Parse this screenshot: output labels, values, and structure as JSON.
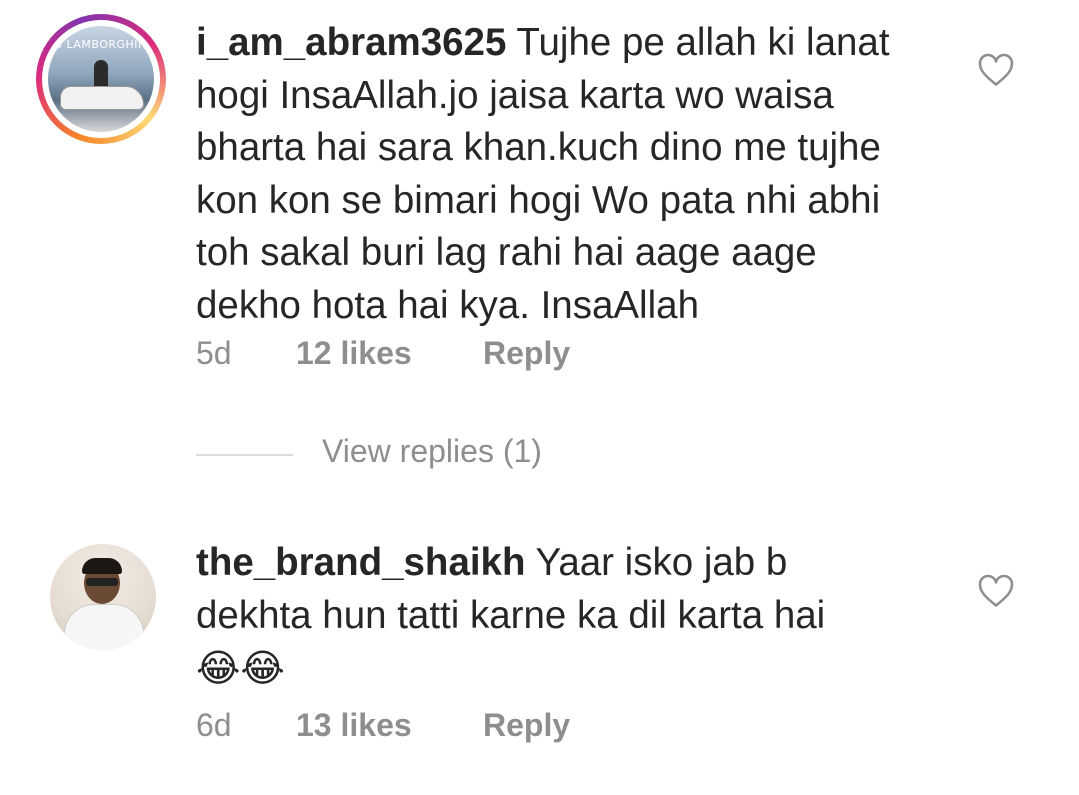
{
  "comments": [
    {
      "username": "i_am_abram3625",
      "text": "Tujhe pe allah ki lanat hogi InsaAllah.jo jaisa karta wo waisa bharta hai sara khan.kuch dino me tujhe kon kon se bimari hogi Wo pata nhi abhi toh sakal buri lag rahi hai aage aage dekho hota hai kya. InsaAllah",
      "lines": [
        "Tujhe pe allah ki lanat",
        "hogi InsaAllah.jo jaisa karta wo waisa",
        "bharta hai sara khan.kuch dino me tujhe",
        "kon kon se bimari hogi Wo pata nhi abhi",
        "toh sakal buri lag rahi hai aage aage",
        "dekho hota hai kya. InsaAllah"
      ],
      "avatar_banner": "'S LAMBORGHINI",
      "age": "5d",
      "likes": "12 likes",
      "reply_label": "Reply",
      "view_replies": "View replies (1)"
    },
    {
      "username": "the_brand_shaikh",
      "lines": [
        "Yaar isko jab b",
        "dekhta hun tatti karne ka dil karta hai"
      ],
      "emojis": "😂😂",
      "age": "6d",
      "likes": "13 likes",
      "reply_label": "Reply"
    }
  ],
  "icons": {
    "like": "heart-outline-icon"
  },
  "colors": {
    "text": "#262626",
    "meta": "#8e8e8e",
    "divider": "#dbdbdb",
    "ring_gradient": [
      "#f58529",
      "#dd2a7b",
      "#8134af",
      "#feda77"
    ]
  }
}
